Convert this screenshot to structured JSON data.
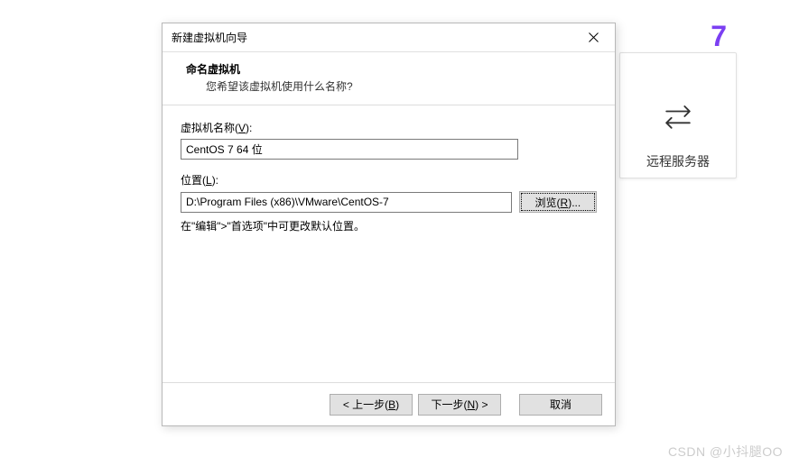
{
  "background": {
    "number": "7",
    "label": "远程服务器"
  },
  "dialog": {
    "title": "新建虚拟机向导",
    "header": {
      "heading": "命名虚拟机",
      "sub": "您希望该虚拟机使用什么名称?"
    },
    "vm_name": {
      "label_prefix": "虚拟机名称(",
      "label_key": "V",
      "label_suffix": "):",
      "value": "CentOS 7 64 位"
    },
    "location": {
      "label_prefix": "位置(",
      "label_key": "L",
      "label_suffix": "):",
      "value": "D:\\Program Files (x86)\\VMware\\CentOS-7",
      "browse_prefix": "浏览(",
      "browse_key": "R",
      "browse_suffix": ")..."
    },
    "hint": "在\"编辑\">\"首选项\"中可更改默认位置。",
    "footer": {
      "back_prefix": "< 上一步(",
      "back_key": "B",
      "back_suffix": ")",
      "next_prefix": "下一步(",
      "next_key": "N",
      "next_suffix": ") >",
      "cancel": "取消"
    }
  },
  "watermark": "CSDN @小抖腿OO"
}
